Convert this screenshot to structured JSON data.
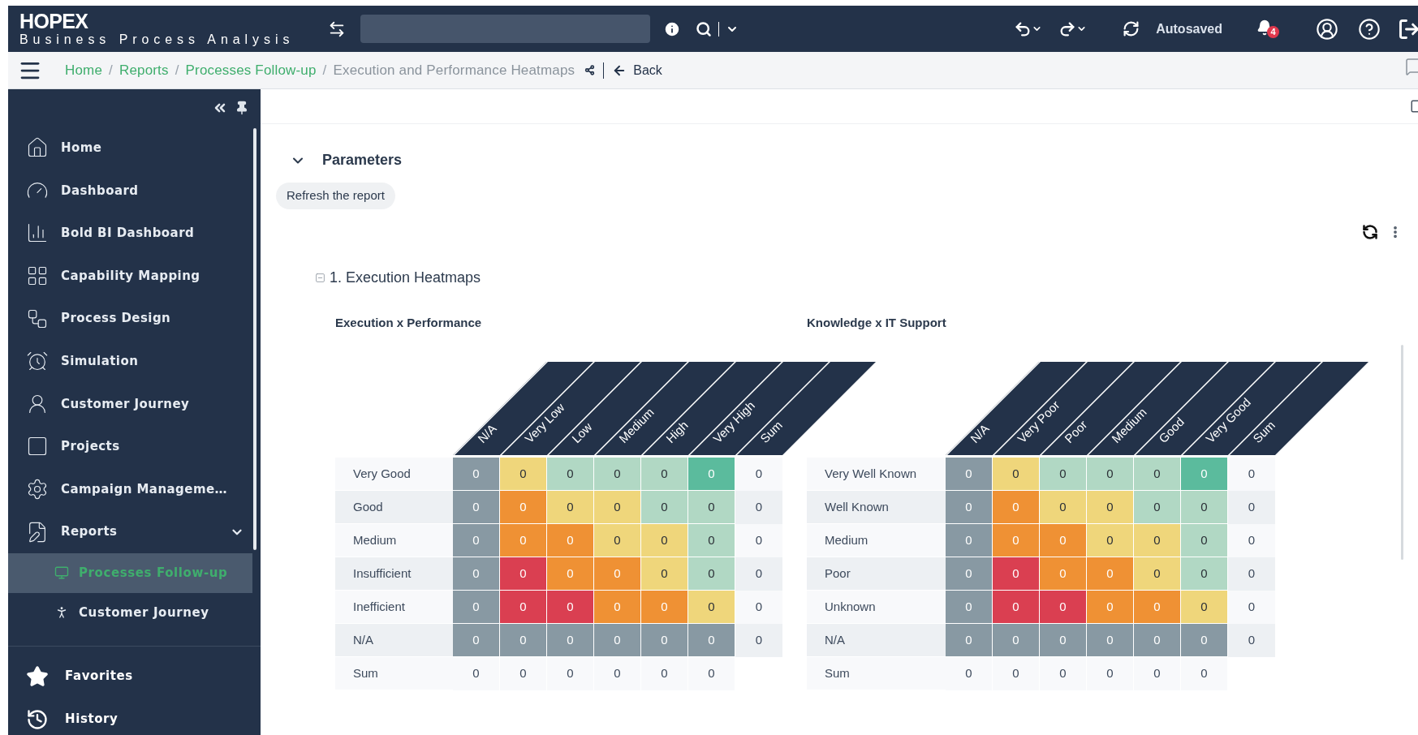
{
  "header": {
    "logo_title": "HOPEX",
    "logo_subtitle": "Business Process Analysis",
    "status": "Autosaved",
    "notification_count": "4"
  },
  "breadcrumb": {
    "items": [
      {
        "label": "Home",
        "current": false
      },
      {
        "separator": "/",
        "label": "Reports",
        "current": false
      },
      {
        "separator": "/",
        "label": "Processes Follow-up",
        "current": false
      },
      {
        "separator": "/",
        "label": "Execution and Performance Heatmaps",
        "current": true
      }
    ],
    "back": "Back"
  },
  "sidebar": {
    "items": [
      {
        "label": "Home",
        "selected": false
      },
      {
        "label": "Dashboard",
        "selected": false
      },
      {
        "label": "Bold BI Dashboard",
        "selected": false
      },
      {
        "label": "Capability Mapping",
        "selected": false
      },
      {
        "label": "Process Design",
        "selected": false
      },
      {
        "label": "Simulation",
        "selected": false
      },
      {
        "label": "Customer Journey",
        "selected": false
      },
      {
        "label": "Projects",
        "selected": false
      },
      {
        "label": "Campaign Manageme…",
        "selected": false
      },
      {
        "label": "Reports",
        "selected": false,
        "expanded": true,
        "children": [
          {
            "label": "Processes Follow-up",
            "selected": true
          },
          {
            "label": "Customer Journey",
            "selected": false
          }
        ]
      }
    ],
    "footer_items": [
      {
        "label": "Favorites"
      },
      {
        "label": "History"
      }
    ]
  },
  "parameters": {
    "title": "Parameters",
    "expanded": true,
    "refresh_button": "Refresh the report"
  },
  "section": {
    "title": "1. Execution Heatmaps",
    "expanded": true
  },
  "heatmaps": [
    {
      "title": "Execution x Performance",
      "columns": [
        "N/A",
        "Very Low",
        "Low",
        "Medium",
        "High",
        "Very High",
        "Sum"
      ],
      "rows": [
        {
          "kind": "data",
          "label": "Very Good",
          "cells": [
            {
              "value": "0",
              "color": "#8899a3"
            },
            {
              "value": "0",
              "color": "#efd67b"
            },
            {
              "value": "0",
              "color": "#b1d8c4"
            },
            {
              "value": "0",
              "color": "#b1d8c4"
            },
            {
              "value": "0",
              "color": "#b1d8c4"
            },
            {
              "value": "0",
              "color": "#5bbb9d"
            }
          ],
          "sum": "0"
        },
        {
          "kind": "data",
          "label": "Good",
          "cells": [
            {
              "value": "0",
              "color": "#8899a3"
            },
            {
              "value": "0",
              "color": "#ef9134"
            },
            {
              "value": "0",
              "color": "#efd67b"
            },
            {
              "value": "0",
              "color": "#efd67b"
            },
            {
              "value": "0",
              "color": "#b1d8c4"
            },
            {
              "value": "0",
              "color": "#b1d8c4"
            }
          ],
          "sum": "0"
        },
        {
          "kind": "data",
          "label": "Medium",
          "cells": [
            {
              "value": "0",
              "color": "#8899a3"
            },
            {
              "value": "0",
              "color": "#ef9134"
            },
            {
              "value": "0",
              "color": "#ef9134"
            },
            {
              "value": "0",
              "color": "#efd67b"
            },
            {
              "value": "0",
              "color": "#efd67b"
            },
            {
              "value": "0",
              "color": "#b1d8c4"
            }
          ],
          "sum": "0"
        },
        {
          "kind": "data",
          "label": "Insufficient",
          "cells": [
            {
              "value": "0",
              "color": "#8899a3"
            },
            {
              "value": "0",
              "color": "#da3f51"
            },
            {
              "value": "0",
              "color": "#ef9134"
            },
            {
              "value": "0",
              "color": "#ef9134"
            },
            {
              "value": "0",
              "color": "#efd67b"
            },
            {
              "value": "0",
              "color": "#b1d8c4"
            }
          ],
          "sum": "0"
        },
        {
          "kind": "data",
          "label": "Inefficient",
          "cells": [
            {
              "value": "0",
              "color": "#8899a3"
            },
            {
              "value": "0",
              "color": "#da3f51"
            },
            {
              "value": "0",
              "color": "#da3f51"
            },
            {
              "value": "0",
              "color": "#ef9134"
            },
            {
              "value": "0",
              "color": "#ef9134"
            },
            {
              "value": "0",
              "color": "#efd67b"
            }
          ],
          "sum": "0"
        },
        {
          "kind": "data",
          "label": "N/A",
          "cells": [
            {
              "value": "0",
              "color": "#8899a3"
            },
            {
              "value": "0",
              "color": "#8899a3"
            },
            {
              "value": "0",
              "color": "#8899a3"
            },
            {
              "value": "0",
              "color": "#8899a3"
            },
            {
              "value": "0",
              "color": "#8899a3"
            },
            {
              "value": "0",
              "color": "#8899a3"
            }
          ],
          "sum": "0"
        },
        {
          "kind": "sum",
          "label": "Sum",
          "cells": [
            {
              "value": "0"
            },
            {
              "value": "0"
            },
            {
              "value": "0"
            },
            {
              "value": "0"
            },
            {
              "value": "0"
            },
            {
              "value": "0"
            }
          ]
        }
      ]
    },
    {
      "title": "Knowledge x IT Support",
      "columns": [
        "N/A",
        "Very Poor",
        "Poor",
        "Medium",
        "Good",
        "Very Good",
        "Sum"
      ],
      "rows": [
        {
          "kind": "data",
          "label": "Very Well Known",
          "cells": [
            {
              "value": "0",
              "color": "#8899a3"
            },
            {
              "value": "0",
              "color": "#efd67b"
            },
            {
              "value": "0",
              "color": "#b1d8c4"
            },
            {
              "value": "0",
              "color": "#b1d8c4"
            },
            {
              "value": "0",
              "color": "#b1d8c4"
            },
            {
              "value": "0",
              "color": "#5bbb9d"
            }
          ],
          "sum": "0"
        },
        {
          "kind": "data",
          "label": "Well Known",
          "cells": [
            {
              "value": "0",
              "color": "#8899a3"
            },
            {
              "value": "0",
              "color": "#ef9134"
            },
            {
              "value": "0",
              "color": "#efd67b"
            },
            {
              "value": "0",
              "color": "#efd67b"
            },
            {
              "value": "0",
              "color": "#b1d8c4"
            },
            {
              "value": "0",
              "color": "#b1d8c4"
            }
          ],
          "sum": "0"
        },
        {
          "kind": "data",
          "label": "Medium",
          "cells": [
            {
              "value": "0",
              "color": "#8899a3"
            },
            {
              "value": "0",
              "color": "#ef9134"
            },
            {
              "value": "0",
              "color": "#ef9134"
            },
            {
              "value": "0",
              "color": "#efd67b"
            },
            {
              "value": "0",
              "color": "#efd67b"
            },
            {
              "value": "0",
              "color": "#b1d8c4"
            }
          ],
          "sum": "0"
        },
        {
          "kind": "data",
          "label": "Poor",
          "cells": [
            {
              "value": "0",
              "color": "#8899a3"
            },
            {
              "value": "0",
              "color": "#da3f51"
            },
            {
              "value": "0",
              "color": "#ef9134"
            },
            {
              "value": "0",
              "color": "#ef9134"
            },
            {
              "value": "0",
              "color": "#efd67b"
            },
            {
              "value": "0",
              "color": "#b1d8c4"
            }
          ],
          "sum": "0"
        },
        {
          "kind": "data",
          "label": "Unknown",
          "cells": [
            {
              "value": "0",
              "color": "#8899a3"
            },
            {
              "value": "0",
              "color": "#da3f51"
            },
            {
              "value": "0",
              "color": "#da3f51"
            },
            {
              "value": "0",
              "color": "#ef9134"
            },
            {
              "value": "0",
              "color": "#ef9134"
            },
            {
              "value": "0",
              "color": "#efd67b"
            }
          ],
          "sum": "0"
        },
        {
          "kind": "data",
          "label": "N/A",
          "cells": [
            {
              "value": "0",
              "color": "#8899a3"
            },
            {
              "value": "0",
              "color": "#8899a3"
            },
            {
              "value": "0",
              "color": "#8899a3"
            },
            {
              "value": "0",
              "color": "#8899a3"
            },
            {
              "value": "0",
              "color": "#8899a3"
            },
            {
              "value": "0",
              "color": "#8899a3"
            }
          ],
          "sum": "0"
        },
        {
          "kind": "sum",
          "label": "Sum",
          "cells": [
            {
              "value": "0"
            },
            {
              "value": "0"
            },
            {
              "value": "0"
            },
            {
              "value": "0"
            },
            {
              "value": "0"
            },
            {
              "value": "0"
            }
          ]
        }
      ]
    }
  ]
}
